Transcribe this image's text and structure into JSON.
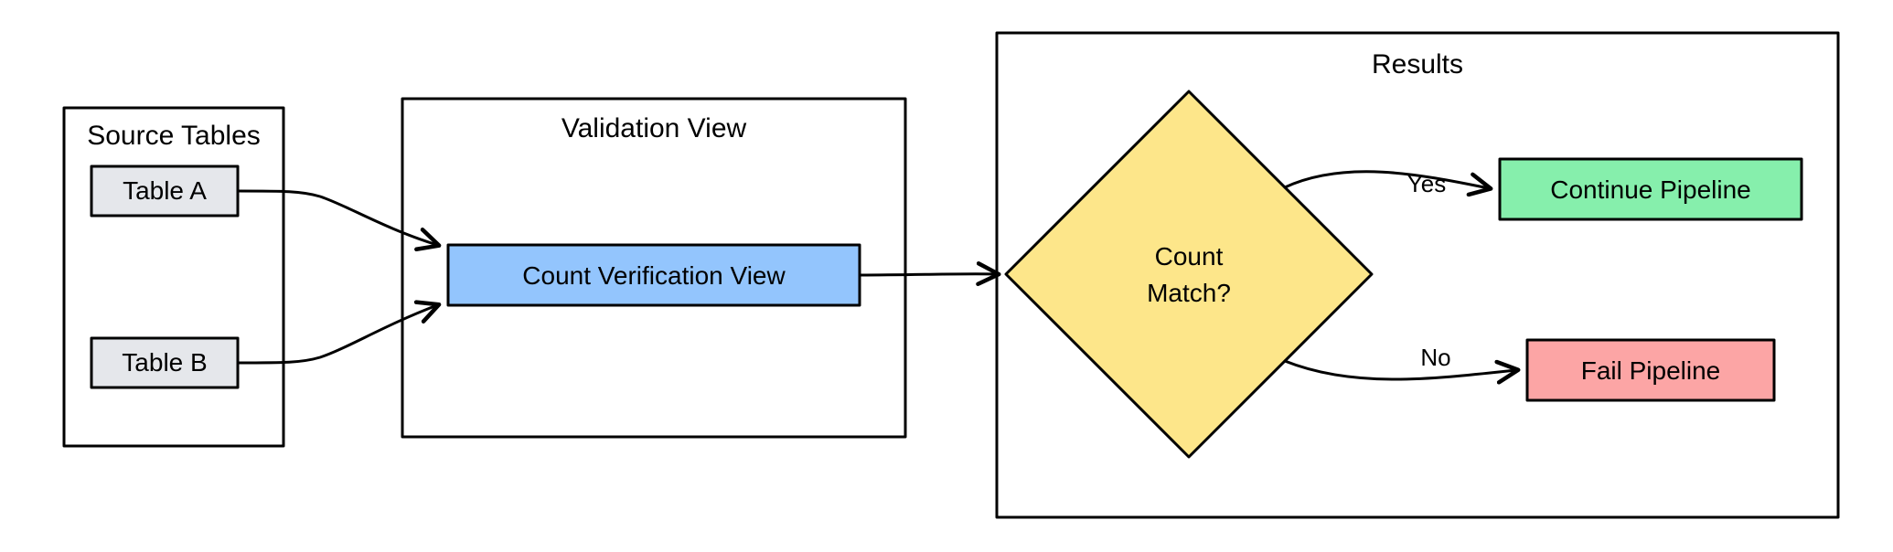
{
  "groups": {
    "source": {
      "title": "Source Tables"
    },
    "validation": {
      "title": "Validation View"
    },
    "results": {
      "title": "Results"
    }
  },
  "nodes": {
    "tableA": {
      "label": "Table A"
    },
    "tableB": {
      "label": "Table B"
    },
    "countView": {
      "label": "Count Verification View"
    },
    "decision": {
      "line1": "Count",
      "line2": "Match?"
    },
    "continue": {
      "label": "Continue Pipeline"
    },
    "fail": {
      "label": "Fail Pipeline"
    }
  },
  "edges": {
    "yes": {
      "label": "Yes"
    },
    "no": {
      "label": "No"
    }
  },
  "colors": {
    "gray": "#e5e7eb",
    "blue": "#93c5fd",
    "yellow": "#fde68a",
    "green": "#86efac",
    "red": "#fca5a5",
    "stroke": "#000000"
  }
}
